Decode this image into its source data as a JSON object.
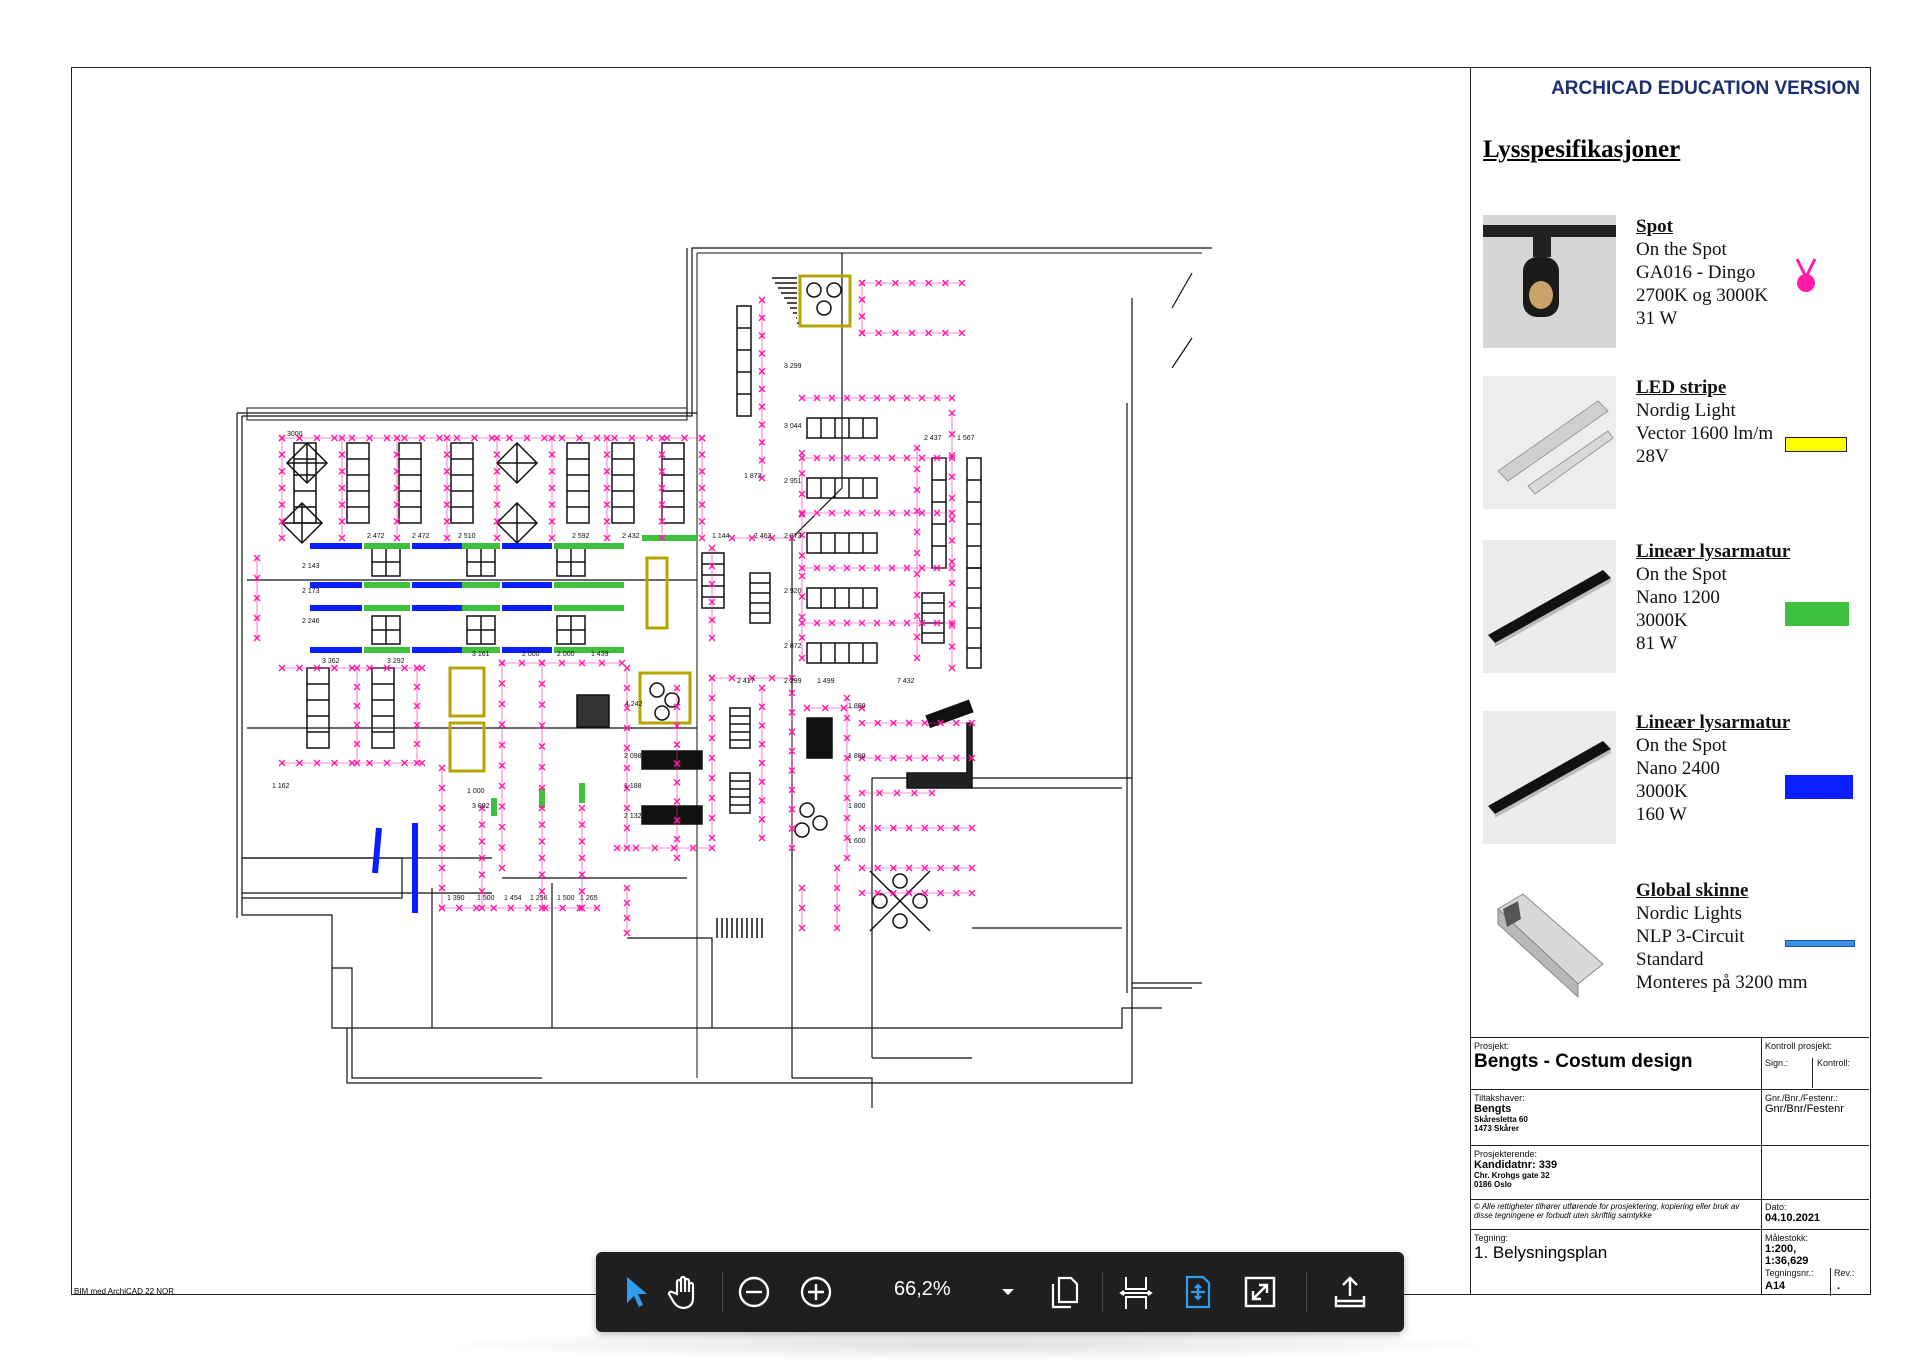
{
  "header": {
    "edu_version": "ARCHICAD EDUCATION VERSION"
  },
  "specs": {
    "title": "Lysspesifikasjoner",
    "items": [
      {
        "name": "Spot",
        "lines": [
          "On the Spot",
          "GA016 - Dingo",
          "2700K og 3000K",
          "31 W"
        ],
        "swatch_color": "#ff1aa8",
        "icon": "spot-light-icon"
      },
      {
        "name": "LED stripe",
        "lines": [
          "Nordig Light",
          "Vector 1600 lm/m",
          "28V"
        ],
        "swatch_color": "#ffff00",
        "icon": "led-strip-icon"
      },
      {
        "name": "Lineær lysarmatur",
        "lines": [
          "On the Spot",
          "Nano 1200",
          "3000K",
          "81 W"
        ],
        "swatch_color": "#3ec13e",
        "icon": "linear-fixture-icon"
      },
      {
        "name": "Lineær lysarmatur",
        "lines": [
          "On the Spot",
          "Nano 2400",
          "3000K",
          "160 W"
        ],
        "swatch_color": "#0a1eff",
        "icon": "linear-fixture-icon"
      },
      {
        "name": "Global skinne",
        "lines": [
          "Nordic Lights",
          "NLP 3-Circuit",
          "Standard",
          "Monteres på 3200 mm"
        ],
        "swatch_color": "#3a8fe8",
        "icon": "track-rail-icon"
      }
    ]
  },
  "title_block": {
    "prosjekt_label": "Prosjekt:",
    "prosjekt": "Bengts - Costum design",
    "kontroll_label": "Kontroll prosjekt:",
    "sign_label": "Sign.:",
    "kontroll2_label": "Kontroll:",
    "tiltakshaver_label": "Tiltakshaver:",
    "tiltakshaver": "Bengts",
    "tiltakshaver_addr1": "Skåresletta 60",
    "tiltakshaver_addr2": "1473 Skårer",
    "gnr_label": "Gnr./Bnr./Festenr.:",
    "gnr": "Gnr/Bnr/Festenr",
    "prosjekterende_label": "Prosjekterende:",
    "prosjekterende": "Kandidatnr: 339",
    "prosjekterende_addr1": "Chr. Krohgs gate 32",
    "prosjekterende_addr2": "0186 Oslo",
    "rights": "© Alle rettigheter tilhører utførende for prosjektering, kopiering eller bruk av disse tegningene er forbudt uten skriftlig samtykke",
    "dato_label": "Dato:",
    "dato": "04.10.2021",
    "malestokk_label": "Målestokk:",
    "malestokk": "1:200, 1:36,629",
    "tegning_label": "Tegning:",
    "tegning": "1. Belysningsplan",
    "tegningsnr_label": "Tegningsnr.:",
    "tegningsnr": "A14",
    "rev_label": "Rev.:",
    "rev": "."
  },
  "footer_note": "BIM med ArchiCAD 22 NOR",
  "toolbar": {
    "zoom": "66,2%",
    "tools": [
      "select-arrow-icon",
      "hand-pan-icon",
      "zoom-out-icon",
      "zoom-in-icon",
      "zoom-dropdown-icon",
      "page-view-icon",
      "fit-width-icon",
      "fit-page-icon",
      "fullscreen-icon",
      "share-icon"
    ]
  },
  "plan": {
    "dimensions": [
      "3000",
      "2 472",
      "2 472",
      "2 510",
      "2 592",
      "2 432",
      "2 462",
      "2 417",
      "2 299",
      "1 499",
      "7 432",
      "3 362",
      "3 292",
      "3 161",
      "2 000",
      "2 000",
      "1 439",
      "1 144",
      "1 872",
      "2 437",
      "1 567",
      "4 242",
      "3 299",
      "3 044",
      "2 951",
      "2 873",
      "2 920",
      "2 872",
      "2 143",
      "2 173",
      "2 246",
      "1 390",
      "1 500",
      "1 454",
      "1 256",
      "1 500",
      "1 265",
      "1 800",
      "1 800",
      "1 800",
      "1 600",
      "2 098",
      "1 188",
      "2 132",
      "1 162",
      "1 000",
      "3 002"
    ]
  }
}
